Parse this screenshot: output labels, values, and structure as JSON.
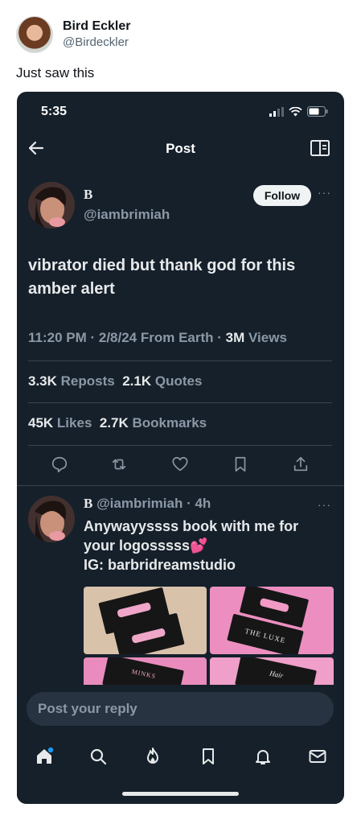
{
  "outer": {
    "author_name": "Bird Eckler",
    "author_handle": "@Birdeckler",
    "text": "Just saw this"
  },
  "status_bar": {
    "time": "5:35"
  },
  "topbar": {
    "title": "Post"
  },
  "post": {
    "name": "B",
    "handle": "@iambrimiah",
    "follow_label": "Follow",
    "more": "···",
    "text": "vibrator died but thank god for this amber alert",
    "meta": {
      "time_date": "11:20 PM · 2/8/24 From Earth ·",
      "views_count": "3M",
      "views_label": "Views"
    },
    "stats": {
      "reposts_count": "3.3K",
      "reposts_label": "Reposts",
      "quotes_count": "2.1K",
      "quotes_label": "Quotes",
      "likes_count": "45K",
      "likes_label": "Likes",
      "bookmarks_count": "2.7K",
      "bookmarks_label": "Bookmarks"
    }
  },
  "reply": {
    "name": "B",
    "handle_time": "@iambrimiah · 4h",
    "more": "···",
    "line1": "Anywayyssss book with me for",
    "line2": "your logosssss💕",
    "line3": "IG: barbridreamstudio",
    "media_texts": [
      "THE LUXE",
      "MINKS",
      "Hair"
    ]
  },
  "reply_input": {
    "placeholder": "Post your reply"
  },
  "nav_icons": [
    "home-icon",
    "search-icon",
    "flame-icon",
    "bookmark-icon",
    "bell-icon",
    "mail-icon"
  ],
  "colors": {
    "background": "#15202b",
    "text": "#e7e9ea",
    "secondary": "#8b98a5",
    "accent": "#1d9bf0"
  }
}
